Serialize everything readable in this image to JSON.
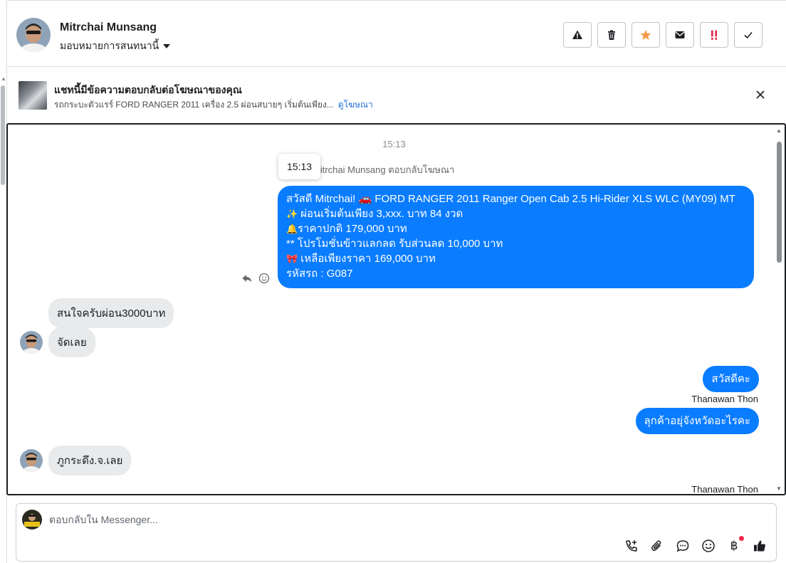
{
  "header": {
    "name": "Mitrchai Munsang",
    "assign_label": "มอบหมายการสนทนานี้",
    "actions": [
      {
        "name": "report-icon",
        "color": "#1c1e21"
      },
      {
        "name": "trash-icon",
        "color": "#1c1e21"
      },
      {
        "name": "star-icon",
        "color": "#f2994a"
      },
      {
        "name": "envelope-icon",
        "color": "#1c1e21"
      },
      {
        "name": "priority-icon",
        "color": "#e41e3f"
      },
      {
        "name": "check-icon",
        "color": "#1c1e21"
      }
    ]
  },
  "ad_banner": {
    "title": "แชทนี้มีข้อความตอบกลับต่อโฆษณาของคุณ",
    "subtitle": "รถกระบะตัวแรร์ FORD RANGER 2011 เครื่อง 2.5 ผ่อนสบายๆ เริ่มต้นเพียง...",
    "link": "ดูโฆษณา"
  },
  "conversation": {
    "timestamp": "15:13",
    "tooltip": "15:13",
    "replied_label": "Mitrchai Munsang ตอบกลับโฆษณา",
    "ad_message": [
      {
        "emoji": "",
        "text": "สวัสดี Mitrchai! 🚗  FORD RANGER 2011 Ranger Open Cab 2.5 Hi-Rider XLS WLC (MY09) MT"
      },
      {
        "emoji": "✨",
        "text": " ผ่อนเริ่มต้นเพียง 3,xxx. บาท 84 งวด"
      },
      {
        "emoji": "🔔",
        "text": "ราคาปกติ 179,000 บาท"
      },
      {
        "emoji": "",
        "text": "** โปรโมชั่นข้าวแลกลด รับส่วนลด 10,000 บาท"
      },
      {
        "emoji": "🎀",
        "text": " เหลือเพียงราคา 169,000 บาท"
      },
      {
        "emoji": "",
        "text": " รหัสรถ : G087"
      }
    ],
    "incoming": [
      "สนใจครับผ่อน3000บาท",
      "จัดเลย",
      "ภูกระดึง.จ.เลย"
    ],
    "outgoing": [
      "สวัสดีคะ",
      "ลุกค้าอยุ่จังหวัดอะไรคะ"
    ],
    "sender_name": "Thanawan Thon",
    "accent": "#0a7cff"
  },
  "composer": {
    "placeholder": "ตอบกลับใน Messenger...",
    "tools": [
      "call-add-icon",
      "attachment-icon",
      "saved-reply-icon",
      "emoji-icon",
      "baht-icon",
      "thumbs-up-icon"
    ]
  }
}
